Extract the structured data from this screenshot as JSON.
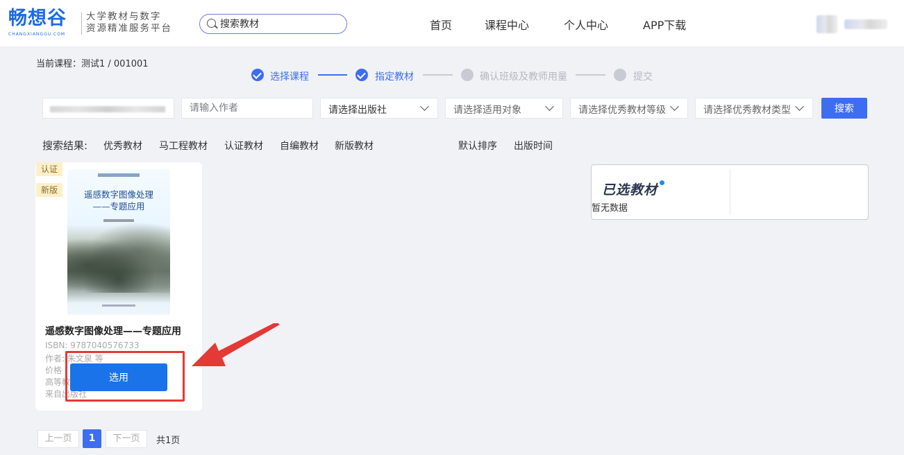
{
  "brand": {
    "logo_text": "畅想谷",
    "logo_subtext": "CHANGXIANGGU.COM",
    "tagline_line1": "大学教材与数字",
    "tagline_line2": "资源精准服务平台",
    "color": "#1a6be6"
  },
  "header": {
    "search_placeholder": "搜索教材",
    "nav": [
      "首页",
      "课程中心",
      "个人中心",
      "APP下载"
    ]
  },
  "course": {
    "label": "当前课程：测试1 / 001001"
  },
  "steps": [
    {
      "label": "选择课程",
      "state": "done"
    },
    {
      "label": "指定教材",
      "state": "done"
    },
    {
      "label": "确认班级及教师用量",
      "state": "todo"
    },
    {
      "label": "提交",
      "state": "todo"
    }
  ],
  "filters": {
    "author_placeholder": "请输入作者",
    "publisher": "请选择出版社",
    "audience": "请选择适用对象",
    "level": "请选择优秀教材等级",
    "type": "请选择优秀教材类型",
    "search_button": "搜索"
  },
  "results": {
    "label": "搜索结果:",
    "tabs": [
      "优秀教材",
      "马工程教材",
      "认证教材",
      "自编教材",
      "新版教材"
    ],
    "sorts": [
      "默认排序",
      "出版时间"
    ]
  },
  "book": {
    "badges": [
      "认证",
      "新版"
    ],
    "cover_title_line1": "遥感数字图像处理",
    "cover_title_line2": "——专题应用",
    "title": "遥感数字图像处理——专题应用",
    "isbn": "ISBN: 9787040576733",
    "author": "作者: 朱文泉 等",
    "meta_line3": "价格",
    "meta_line4": "高等教育出版社",
    "meta_line5": "来自出版社",
    "select_button": "选用"
  },
  "selected": {
    "title": "已选教材",
    "empty": "暂无数据"
  },
  "pagination": {
    "prev": "上一页",
    "current": "1",
    "next": "下一页",
    "total": "共1页"
  },
  "colors": {
    "primary": "#3d6df0",
    "select_button": "#1a73e8",
    "highlight": "#e53935"
  }
}
